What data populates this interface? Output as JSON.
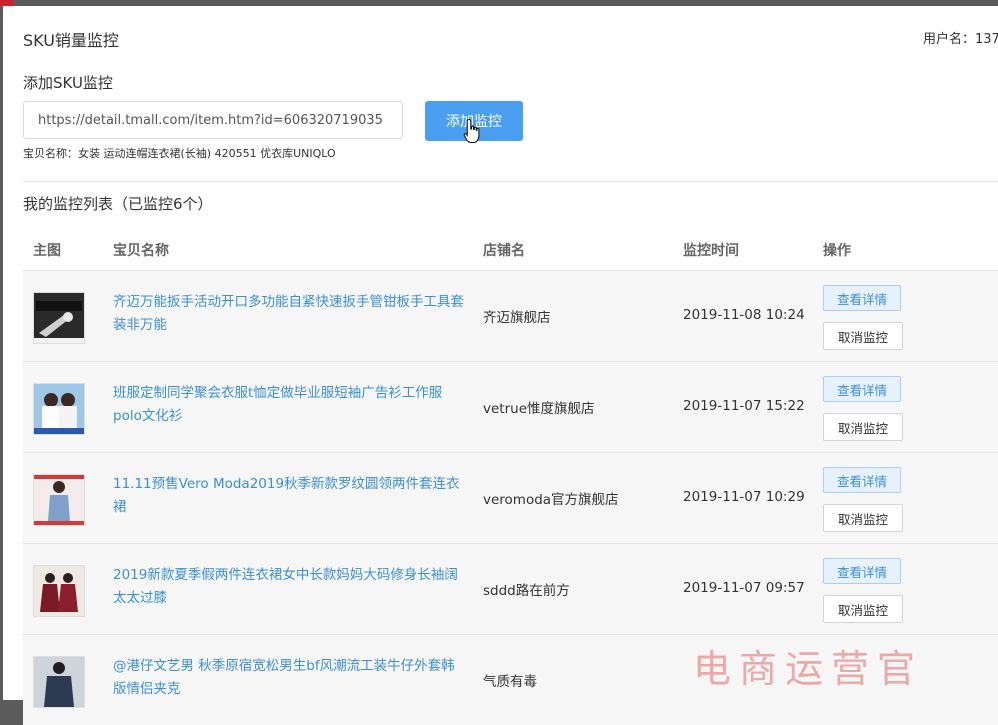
{
  "header": {
    "title": "SKU销量监控",
    "username": "用户名：137"
  },
  "add_section": {
    "title": "添加SKU监控",
    "url_value": "https://detail.tmall.com/item.htm?id=606320719035",
    "button_label": "添加监控",
    "item_name": "宝贝名称：女装 运动连帽连衣裙(长袖) 420551 优衣库UNIQLO"
  },
  "list": {
    "title": "我的监控列表（已监控6个）",
    "columns": [
      "主图",
      "宝贝名称",
      "店铺名",
      "监控时间",
      "操作"
    ],
    "rows": [
      {
        "name": "齐迈万能扳手活动开口多功能自紧快速扳手管钳板手工具套装非万能",
        "shop": "齐迈旗舰店",
        "time": "2019-11-08 10:24",
        "detail": "查看详情",
        "cancel": "取消监控"
      },
      {
        "name": "班服定制同学聚会衣服t恤定做毕业服短袖广告衫工作服polo文化衫",
        "shop": "vetrue惟度旗舰店",
        "time": "2019-11-07 15:22",
        "detail": "查看详情",
        "cancel": "取消监控"
      },
      {
        "name": "11.11预售Vero Moda2019秋季新款罗纹圆领两件套连衣裙",
        "shop": "veromoda官方旗舰店",
        "time": "2019-11-07 10:29",
        "detail": "查看详情",
        "cancel": "取消监控"
      },
      {
        "name": "2019新款夏季假两件连衣裙女中长款妈妈大码修身长袖阔太太过膝",
        "shop": "sddd路在前方",
        "time": "2019-11-07 09:57",
        "detail": "查看详情",
        "cancel": "取消监控"
      },
      {
        "name": "@港仔文艺男 秋季原宿宽松男生bf风潮流工装牛仔外套韩版情侣夹克",
        "shop": "气质有毒",
        "time": "",
        "detail": "",
        "cancel": ""
      }
    ]
  },
  "watermark": "电商运营官"
}
